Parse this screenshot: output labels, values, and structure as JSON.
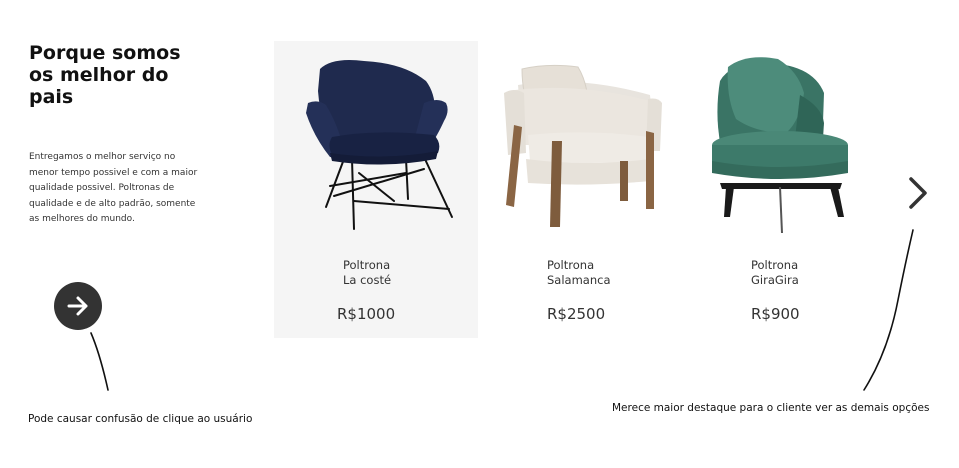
{
  "section": {
    "title": "Porque somos\nos melhor do\npais",
    "description": "Entregamos o melhor serviço no menor tempo possivel e com a maior qualidade possivel. Poltronas de qualidade e de alto padrão, somente as melhores do mundo.",
    "next_button_icon": "arrow-right-icon"
  },
  "products": [
    {
      "name": "Poltrona\nLa costé",
      "price": "R$1000",
      "color": "#1f2a4e",
      "image_icon": "navy-armchair-icon"
    },
    {
      "name": "Poltrona\nSalamanca",
      "price": "R$2500",
      "color": "#ebe6df",
      "image_icon": "cream-armchair-icon"
    },
    {
      "name": "Poltrona\nGiraGira",
      "price": "R$900",
      "color": "#3d7a6a",
      "image_icon": "green-swivel-armchair-icon"
    }
  ],
  "carousel": {
    "next_icon": "chevron-right-icon"
  },
  "annotations": {
    "left_note": "Pode causar confusão de clique ao usuário",
    "right_note": "Merece maior destaque para o cliente ver as demais opções"
  },
  "colors": {
    "accent_dark": "#333333",
    "featured_card_bg": "#f5f5f5"
  }
}
